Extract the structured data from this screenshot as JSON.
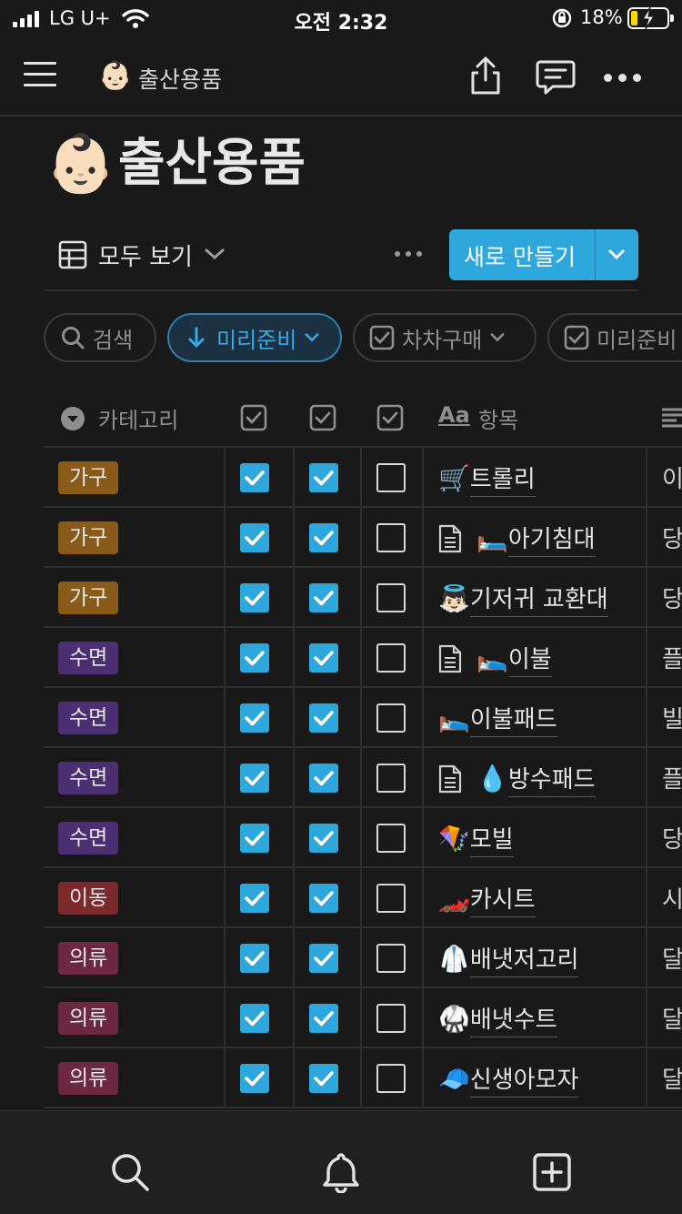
{
  "status_bar": {
    "carrier": "LG U+",
    "time": "오전 2:32",
    "battery_pct": "18%",
    "battery_level": 0.18
  },
  "nav": {
    "page_emoji": "👶🏻",
    "page_title": "출산용품"
  },
  "page": {
    "emoji": "👶🏻",
    "title": "출산용품"
  },
  "view": {
    "label": "모두 보기",
    "new_button": "새로 만들기"
  },
  "filters": [
    {
      "label": "검색",
      "icon": "search-icon"
    },
    {
      "label": "미리준비",
      "icon": "arrow-down-icon",
      "active": true
    },
    {
      "label": "차차구매",
      "icon": "checkbox-icon"
    },
    {
      "label": "미리준비",
      "icon": "checkbox-icon"
    }
  ],
  "table": {
    "headers": {
      "category": "카테고리",
      "item_prefix": "Aa",
      "item": "항목"
    },
    "rows": [
      {
        "category": "가구",
        "color": "#8a5a19",
        "c1": true,
        "c2": true,
        "c3": false,
        "doc": false,
        "emoji": "🛒",
        "name": "트롤리",
        "next": "이"
      },
      {
        "category": "가구",
        "color": "#8a5a19",
        "c1": true,
        "c2": true,
        "c3": false,
        "doc": true,
        "emoji": "🛏️",
        "name": "아기침대",
        "next": "당"
      },
      {
        "category": "가구",
        "color": "#8a5a19",
        "c1": true,
        "c2": true,
        "c3": false,
        "doc": false,
        "emoji": "👼🏻",
        "name": "기저귀 교환대",
        "next": "당"
      },
      {
        "category": "수면",
        "color": "#4b2f73",
        "c1": true,
        "c2": true,
        "c3": false,
        "doc": true,
        "emoji": "🛌",
        "name": "이불",
        "next": "플"
      },
      {
        "category": "수면",
        "color": "#4b2f73",
        "c1": true,
        "c2": true,
        "c3": false,
        "doc": false,
        "emoji": "🛌",
        "name": "이불패드",
        "next": "빌"
      },
      {
        "category": "수면",
        "color": "#4b2f73",
        "c1": true,
        "c2": true,
        "c3": false,
        "doc": true,
        "emoji": "💧",
        "name": "방수패드",
        "next": "플"
      },
      {
        "category": "수면",
        "color": "#4b2f73",
        "c1": true,
        "c2": true,
        "c3": false,
        "doc": false,
        "emoji": "🪁",
        "name": "모빌",
        "next": "당"
      },
      {
        "category": "이동",
        "color": "#7a2a2a",
        "c1": true,
        "c2": true,
        "c3": false,
        "doc": false,
        "emoji": "🏎️",
        "name": "카시트",
        "next": "시"
      },
      {
        "category": "의류",
        "color": "#6b2840",
        "c1": true,
        "c2": true,
        "c3": false,
        "doc": false,
        "emoji": "🥼",
        "name": "배냇저고리",
        "next": "달"
      },
      {
        "category": "의류",
        "color": "#6b2840",
        "c1": true,
        "c2": true,
        "c3": false,
        "doc": false,
        "emoji": "🥋",
        "name": "배냇수트",
        "next": "달"
      },
      {
        "category": "의류",
        "color": "#6b2840",
        "c1": true,
        "c2": true,
        "c3": false,
        "doc": false,
        "emoji": "🧢",
        "name": "신생아모자",
        "next": "달"
      }
    ]
  },
  "bottom_bar": [
    "search-icon",
    "bell-icon",
    "add-page-icon"
  ],
  "colors": {
    "accent": "#2ea7dd",
    "background": "#191919"
  }
}
